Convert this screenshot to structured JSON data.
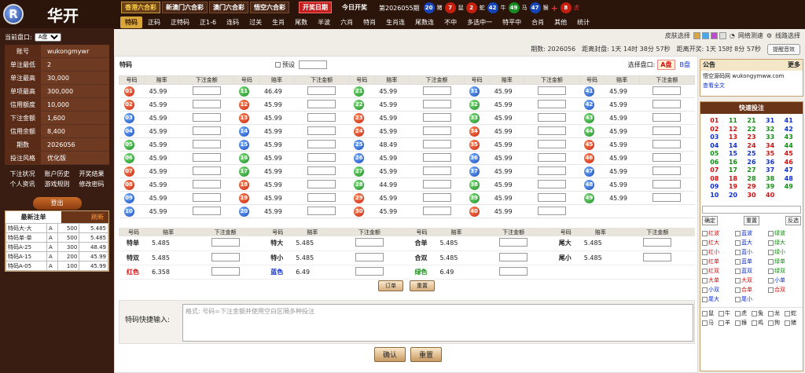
{
  "app_name": "华开",
  "logo_letter": "R",
  "top_tabs": [
    "香港六合彩",
    "新澳门六合彩",
    "澳门六合彩",
    "悟空六合彩"
  ],
  "draw_date_label": "开奖日期",
  "today_label": "今日开奖",
  "draw_period": "第2026055期",
  "draw_balls": [
    {
      "n": "20",
      "z": "猪",
      "c": "#1545b8"
    },
    {
      "n": "7",
      "z": "鼠",
      "c": "#c41f0f"
    },
    {
      "n": "2",
      "z": "蛇",
      "c": "#c41f0f"
    },
    {
      "n": "42",
      "z": "牛",
      "c": "#1545b8"
    },
    {
      "n": "49",
      "z": "马",
      "c": "#1a8a25"
    },
    {
      "n": "47",
      "z": "猴",
      "c": "#1545b8"
    }
  ],
  "special_ball": {
    "n": "8",
    "z": "虎",
    "c": "#c41f0f"
  },
  "nav": [
    "特码",
    "正码",
    "正特码",
    "正1-6",
    "连码",
    "过关",
    "生肖",
    "尾数",
    "半波",
    "六肖",
    "特肖",
    "生肖连",
    "尾数连",
    "不中",
    "多选中一",
    "特平中",
    "合肖",
    "其他",
    "统计"
  ],
  "skin_label": "皮肤选择",
  "skin_colors": [
    "#d9a63a",
    "#4aa8e8",
    "#c04ad0",
    "#e0e0e0"
  ],
  "net_test": "网络测速",
  "line_select": "线路选择",
  "period_label": "期数: 2026056",
  "close_label": "距离封盘: 1天 14时 38分 57秒",
  "open_label": "距离开奖: 1天 15时 8分 57秒",
  "sound_btn": "提醒音效",
  "plate": {
    "label": "当前盘口:",
    "value": "A盘"
  },
  "account": [
    {
      "k": "账号",
      "v": "wukongmywr"
    },
    {
      "k": "单注最低",
      "v": "2"
    },
    {
      "k": "单注最高",
      "v": "30,000"
    },
    {
      "k": "单项最高",
      "v": "300,000"
    },
    {
      "k": "信用额度",
      "v": "10,000"
    },
    {
      "k": "下注金额",
      "v": "1,600"
    },
    {
      "k": "信用余额",
      "v": "8,400"
    },
    {
      "k": "期数",
      "v": "2026056"
    },
    {
      "k": "投注风格",
      "v": "优化版"
    }
  ],
  "side_links": [
    "下注状况",
    "账户历史",
    "开奖结果",
    "个人资讯",
    "游戏规则",
    "修改密码"
  ],
  "logout": "登出",
  "latest": {
    "title": "最新注单",
    "refresh": "刷新",
    "rows": [
      [
        "特码大-大",
        "A",
        "500",
        "5.485"
      ],
      [
        "特码单-单",
        "A",
        "500",
        "5.485"
      ],
      [
        "特码A-25",
        "A",
        "300",
        "48.49"
      ],
      [
        "特码A-15",
        "A",
        "200",
        "45.99"
      ],
      [
        "特码A-05",
        "A",
        "100",
        "45.99"
      ]
    ]
  },
  "main": {
    "title": "特码",
    "preset": "预设",
    "plate_label": "选择盘口:",
    "plate_a": "A盘",
    "plate_b": "B盘"
  },
  "headers": {
    "num": "号码",
    "odds": "赔率",
    "amount": "下注金额"
  },
  "tm_rows": [
    [
      [
        "01",
        "r",
        "45.99"
      ],
      [
        "11",
        "g",
        "46.49"
      ],
      [
        "21",
        "g",
        "45.99"
      ],
      [
        "31",
        "b",
        "45.99"
      ],
      [
        "41",
        "b",
        "45.99"
      ]
    ],
    [
      [
        "02",
        "r",
        "45.99"
      ],
      [
        "12",
        "r",
        "45.99"
      ],
      [
        "22",
        "g",
        "45.99"
      ],
      [
        "32",
        "g",
        "45.99"
      ],
      [
        "42",
        "b",
        "45.99"
      ]
    ],
    [
      [
        "03",
        "b",
        "45.99"
      ],
      [
        "13",
        "r",
        "45.99"
      ],
      [
        "23",
        "r",
        "45.99"
      ],
      [
        "33",
        "g",
        "45.99"
      ],
      [
        "43",
        "g",
        "45.99"
      ]
    ],
    [
      [
        "04",
        "b",
        "45.99"
      ],
      [
        "14",
        "b",
        "45.99"
      ],
      [
        "24",
        "r",
        "45.99"
      ],
      [
        "34",
        "r",
        "45.99"
      ],
      [
        "44",
        "g",
        "45.99"
      ]
    ],
    [
      [
        "05",
        "g",
        "45.99"
      ],
      [
        "15",
        "b",
        "45.99"
      ],
      [
        "25",
        "b",
        "48.49"
      ],
      [
        "35",
        "r",
        "45.99"
      ],
      [
        "45",
        "r",
        "45.99"
      ]
    ],
    [
      [
        "06",
        "g",
        "45.99"
      ],
      [
        "16",
        "g",
        "45.99"
      ],
      [
        "26",
        "b",
        "45.99"
      ],
      [
        "36",
        "b",
        "45.99"
      ],
      [
        "46",
        "r",
        "45.99"
      ]
    ],
    [
      [
        "07",
        "r",
        "45.99"
      ],
      [
        "17",
        "g",
        "45.99"
      ],
      [
        "27",
        "g",
        "45.99"
      ],
      [
        "37",
        "b",
        "45.99"
      ],
      [
        "47",
        "b",
        "45.99"
      ]
    ],
    [
      [
        "08",
        "r",
        "45.99"
      ],
      [
        "18",
        "r",
        "45.99"
      ],
      [
        "28",
        "g",
        "44.99"
      ],
      [
        "38",
        "g",
        "45.99"
      ],
      [
        "48",
        "b",
        "45.99"
      ]
    ],
    [
      [
        "09",
        "b",
        "45.99"
      ],
      [
        "19",
        "r",
        "45.99"
      ],
      [
        "29",
        "r",
        "45.99"
      ],
      [
        "39",
        "g",
        "45.99"
      ],
      [
        "49",
        "g",
        "45.99"
      ]
    ],
    [
      [
        "10",
        "b",
        "45.99"
      ],
      [
        "20",
        "b",
        "45.99"
      ],
      [
        "30",
        "r",
        "45.99"
      ],
      [
        "40",
        "r",
        "45.99"
      ],
      null
    ]
  ],
  "opt_rows": [
    [
      [
        "特单",
        "5.485",
        ""
      ],
      [
        "特大",
        "5.485",
        ""
      ],
      [
        "合单",
        "5.485",
        ""
      ],
      [
        "尾大",
        "5.485",
        ""
      ]
    ],
    [
      [
        "特双",
        "5.485",
        ""
      ],
      [
        "特小",
        "5.485",
        ""
      ],
      [
        "合双",
        "5.485",
        ""
      ],
      [
        "尾小",
        "5.485",
        ""
      ]
    ],
    [
      [
        "红色",
        "6.358",
        "cr"
      ],
      [
        "蓝色",
        "6.49",
        "cb"
      ],
      [
        "绿色",
        "6.49",
        "cg"
      ],
      null
    ]
  ],
  "order_btn": "订单",
  "reset_btn": "重置",
  "quick": {
    "label": "特码快捷输入:",
    "placeholder": "格式: 号码=下注金额并使用空白区隔多种投注",
    "confirm": "确认",
    "reset": "重置"
  },
  "notice": {
    "title": "公告",
    "more": "更多",
    "text": "悟空源码网 wukongymww.com",
    "link": "查看全文"
  },
  "quick_panel": {
    "title": "快速投注",
    "grid": [
      [
        "01",
        "cr"
      ],
      [
        "11",
        "cg"
      ],
      [
        "21",
        "cg"
      ],
      [
        "31",
        "cb"
      ],
      [
        "41",
        "cb"
      ],
      [
        "02",
        "cr"
      ],
      [
        "12",
        "cr"
      ],
      [
        "22",
        "cg"
      ],
      [
        "32",
        "cg"
      ],
      [
        "42",
        "cb"
      ],
      [
        "03",
        "cb"
      ],
      [
        "13",
        "cr"
      ],
      [
        "23",
        "cr"
      ],
      [
        "33",
        "cg"
      ],
      [
        "43",
        "cg"
      ],
      [
        "04",
        "cb"
      ],
      [
        "14",
        "cb"
      ],
      [
        "24",
        "cr"
      ],
      [
        "34",
        "cr"
      ],
      [
        "44",
        "cg"
      ],
      [
        "05",
        "cg"
      ],
      [
        "15",
        "cb"
      ],
      [
        "25",
        "cb"
      ],
      [
        "35",
        "cr"
      ],
      [
        "45",
        "cr"
      ],
      [
        "06",
        "cg"
      ],
      [
        "16",
        "cg"
      ],
      [
        "26",
        "cb"
      ],
      [
        "36",
        "cb"
      ],
      [
        "46",
        "cr"
      ],
      [
        "07",
        "cr"
      ],
      [
        "17",
        "cg"
      ],
      [
        "27",
        "cg"
      ],
      [
        "37",
        "cb"
      ],
      [
        "47",
        "cb"
      ],
      [
        "08",
        "cr"
      ],
      [
        "18",
        "cr"
      ],
      [
        "28",
        "cg"
      ],
      [
        "38",
        "cg"
      ],
      [
        "48",
        "cb"
      ],
      [
        "09",
        "cb"
      ],
      [
        "19",
        "cr"
      ],
      [
        "29",
        "cr"
      ],
      [
        "39",
        "cg"
      ],
      [
        "49",
        "cg"
      ],
      [
        "10",
        "cb"
      ],
      [
        "20",
        "cb"
      ],
      [
        "30",
        "cr"
      ],
      [
        "40",
        "cr"
      ],
      [
        "",
        ""
      ]
    ],
    "btns": [
      "确定",
      "重置",
      "反选"
    ],
    "checks": [
      [
        "红波",
        "cr"
      ],
      [
        "蓝波",
        "cb"
      ],
      [
        "绿波",
        "cg"
      ],
      [
        "红大",
        "cr"
      ],
      [
        "蓝大",
        "cb"
      ],
      [
        "绿大",
        "cg"
      ],
      [
        "红小",
        "cr"
      ],
      [
        "蓝小",
        "cb"
      ],
      [
        "绿小",
        "cg"
      ],
      [
        "红单",
        "cr"
      ],
      [
        "蓝单",
        "cb"
      ],
      [
        "绿单",
        "cg"
      ],
      [
        "红双",
        "cr"
      ],
      [
        "蓝双",
        "cb"
      ],
      [
        "绿双",
        "cg"
      ],
      [
        "大单",
        "cr"
      ],
      [
        "大双",
        "cr"
      ],
      [
        "小单",
        "cb"
      ],
      [
        "小双",
        "cb"
      ],
      [
        "合单",
        "cr"
      ],
      [
        "合双",
        "cr"
      ],
      [
        "尾大",
        "cb"
      ],
      [
        "尾小",
        "cb"
      ],
      [
        "",
        ""
      ]
    ],
    "zodiacs": [
      "鼠",
      "牛",
      "虎",
      "兔",
      "龙",
      "蛇",
      "马",
      "羊",
      "猴",
      "鸡",
      "狗",
      "猪"
    ]
  }
}
